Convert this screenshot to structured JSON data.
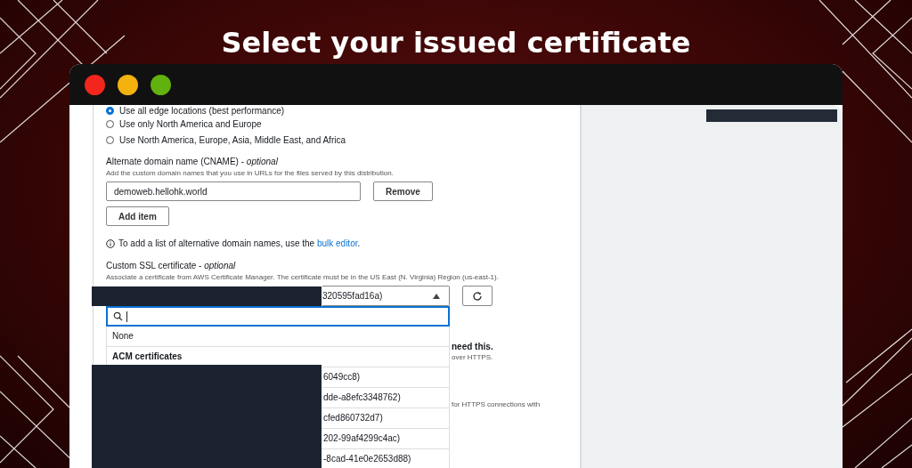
{
  "slide_title": "Select your issued certificate",
  "window": {
    "controls": [
      {
        "color": "#f2261c"
      },
      {
        "color": "#f3b20e"
      },
      {
        "color": "#61b10f"
      }
    ]
  },
  "price_class": {
    "options": [
      {
        "label": "Use all edge locations (best performance)",
        "selected": true
      },
      {
        "label": "Use only North America and Europe",
        "selected": false
      },
      {
        "label": "Use North America, Europe, Asia, Middle East, and Africa",
        "selected": false
      }
    ]
  },
  "cname": {
    "label": "Alternate domain name (CNAME) - *optional*",
    "description": "Add the custom domain names that you use in URLs for the files served by this distribution.",
    "value": "demoweb.hellohk.world",
    "remove": "Remove",
    "add": "Add item",
    "info": "To add a list of alternative domain names, use the",
    "link": "bulk editor",
    "info_end": "."
  },
  "ssl": {
    "label": "Custom SSL certificate - *optional*",
    "description": "Associate a certificate from AWS Certificate Manager. The certificate must be in the US East (N. Virginia) Region (us-east-1).",
    "value": "320595fad16a)",
    "expanded": true,
    "options": [
      {
        "label": "None",
        "kind": "option"
      },
      {
        "label": "ACM certificates",
        "kind": "group"
      },
      {
        "label": "6049cc8)",
        "kind": "option"
      },
      {
        "label": "dde-a8efc3348762)",
        "kind": "option"
      },
      {
        "label": "cfed860732d7)",
        "kind": "option"
      },
      {
        "label": "202-99af4299c4ac)",
        "kind": "option"
      },
      {
        "label": "-8cad-41e0e2653d88)",
        "kind": "option"
      }
    ]
  },
  "hidden_texts": [
    "need this.",
    "over HTTPS.",
    "for HTTPS connections with"
  ]
}
